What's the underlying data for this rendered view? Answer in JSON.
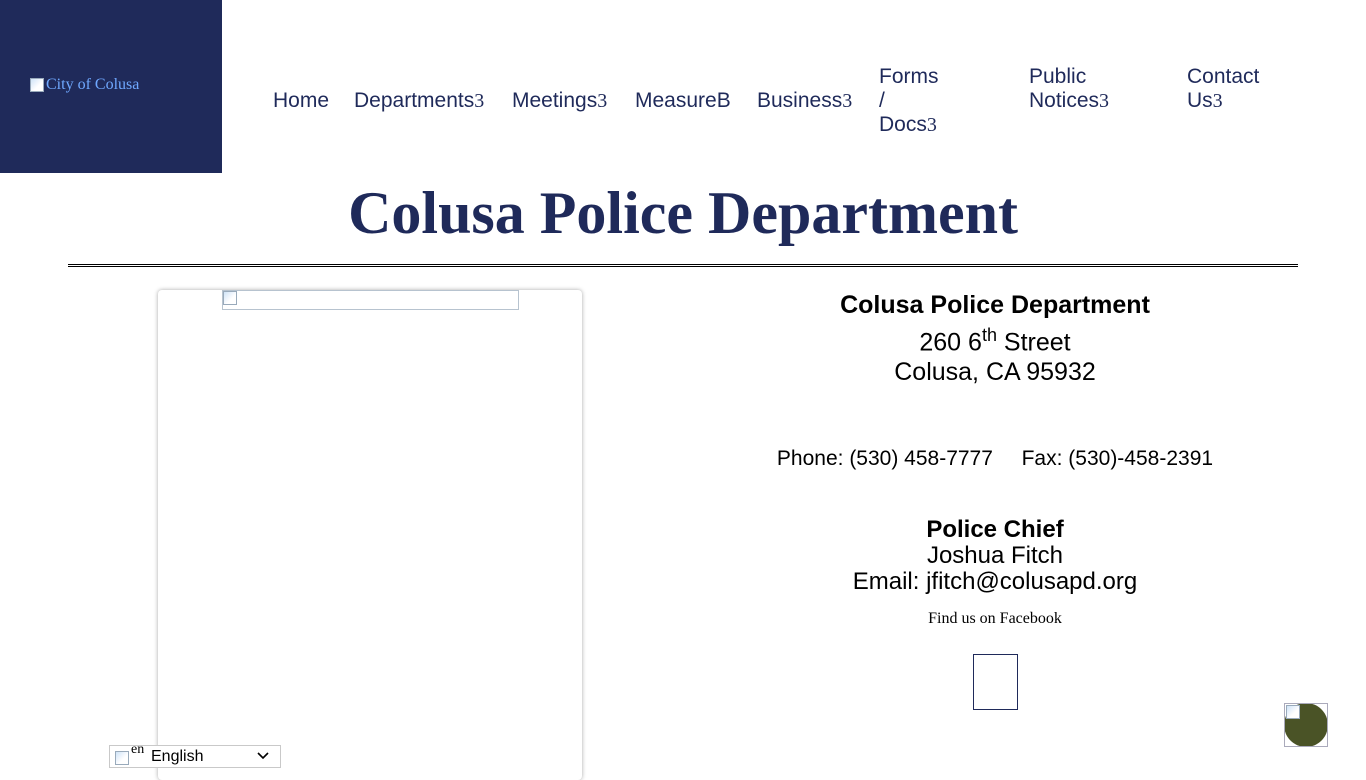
{
  "header": {
    "logo_alt": "City of Colusa",
    "brand_color": "#1f2a5a",
    "nav": [
      {
        "line1": "Home",
        "line2": "",
        "has_caret": false
      },
      {
        "line1": "Departments",
        "line2": "",
        "has_caret": true
      },
      {
        "line1": "Meetings",
        "line2": "",
        "has_caret": true
      },
      {
        "line1": "MeasureB",
        "line2": "",
        "has_caret": false
      },
      {
        "line1": "Business",
        "line2": "",
        "has_caret": true
      },
      {
        "line1": "Forms /",
        "line2": "Docs",
        "has_caret": true
      },
      {
        "line1": "Public",
        "line2": "Notices",
        "has_caret": true
      },
      {
        "line1": "Contact",
        "line2": "Us",
        "has_caret": true
      }
    ],
    "caret_glyph": "3"
  },
  "page": {
    "title": "Colusa Police Department"
  },
  "contact": {
    "name": "Colusa Police Department",
    "street_number": "260 6",
    "street_sup": "th",
    "street_rest": " Street",
    "city_line": "Colusa, CA 95932",
    "phone": "Phone: (530) 458-7777",
    "fax": "Fax: (530)-458-2391",
    "chief_label": "Police Chief",
    "chief_name": "Joshua Fitch",
    "email": "Email: jfitch@colusapd.org",
    "facebook_text": "Find us on Facebook"
  },
  "language": {
    "flag_alt": "en",
    "selected": "English"
  },
  "icons": {
    "chevron": "chevron-down-icon",
    "scroll": "scroll-top-icon",
    "facebook": "facebook-icon"
  }
}
